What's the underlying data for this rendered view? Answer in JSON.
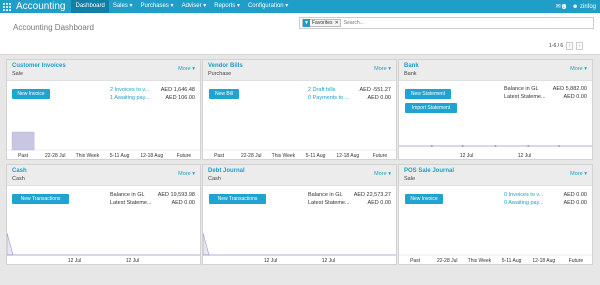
{
  "navbar": {
    "app_title": "Accounting",
    "menu": [
      {
        "label": "Dashboard",
        "active": true
      },
      {
        "label": "Sales ▾"
      },
      {
        "label": "Purchases ▾"
      },
      {
        "label": "Adviser ▾"
      },
      {
        "label": "Reports ▾"
      },
      {
        "label": "Configuration ▾"
      }
    ],
    "messages_count": "1",
    "user": "zinfog",
    "accent": "#1f9ec8"
  },
  "control_panel": {
    "title": "Accounting Dashboard",
    "facet": "Favorites",
    "facet_icon": "filter-icon",
    "search_placeholder": "Search...",
    "pager": "1-6 / 6",
    "prev": "‹",
    "next": "›"
  },
  "cards": {
    "customer_invoices": {
      "title": "Customer Invoices",
      "subtitle": "Sale",
      "more": "More ▾",
      "button": "New Invoice",
      "link1": "2 Invoices to v...",
      "amt1": "AED 1,646.48",
      "link2": "1 Awaiting pay...",
      "amt2": "AED 106.00",
      "bars": [
        {
          "label": "Past",
          "value": 1,
          "highlight": true
        },
        {
          "label": "22-28 Jul",
          "value": 0
        },
        {
          "label": "This Week",
          "value": 0
        },
        {
          "label": "5-11 Aug",
          "value": 0
        },
        {
          "label": "12-18 Aug",
          "value": 0
        },
        {
          "label": "Future",
          "value": 0
        }
      ]
    },
    "vendor_bills": {
      "title": "Vendor Bills",
      "subtitle": "Purchase",
      "more": "More ▾",
      "button": "New Bill",
      "link1": "2 Draft bills",
      "amt1": "AED -551.27",
      "link2": "0 Payments to ...",
      "amt2": "AED 0.00",
      "bars": [
        {
          "label": "Past",
          "value": 0
        },
        {
          "label": "22-28 Jul",
          "value": 0
        },
        {
          "label": "This Week",
          "value": 0
        },
        {
          "label": "5-11 Aug",
          "value": 0
        },
        {
          "label": "12-18 Aug",
          "value": 0
        },
        {
          "label": "Future",
          "value": 0
        }
      ]
    },
    "bank": {
      "title": "Bank",
      "subtitle": "Bank",
      "more": "More ▾",
      "button": "New Statement",
      "button2": "Import Statement",
      "label1": "Balance in GL",
      "amt1": "AED 5,882.00",
      "label2": "Latest Stateme...",
      "amt2": "AED 0.00",
      "ticks": [
        "12 Jul",
        "12 Jul"
      ]
    },
    "cash": {
      "title": "Cash",
      "subtitle": "Cash",
      "more": "More ▾",
      "button": "New Transactions",
      "label1": "Balance in GL",
      "amt1": "AED 19,593.98",
      "label2": "Latest Stateme...",
      "amt2": "AED 0.00",
      "ticks": [
        "12 Jul",
        "12 Jul"
      ]
    },
    "debt_journal": {
      "title": "Debt Journal",
      "subtitle": "Cash",
      "more": "More ▾",
      "button": "New Transactions",
      "label1": "Balance in GL",
      "amt1": "AED 22,573.27",
      "label2": "Latest Stateme...",
      "amt2": "AED 0.00",
      "ticks": [
        "12 Jul",
        "12 Jul"
      ]
    },
    "pos_sale_journal": {
      "title": "POS Sale Journal",
      "subtitle": "Sale",
      "more": "More ▾",
      "button": "New Invoice",
      "link1": "0 Invoices to v...",
      "amt1": "AED 0.00",
      "link2": "0 Awaiting pay...",
      "amt2": "AED 0.00",
      "bars": [
        {
          "label": "Past",
          "value": 0
        },
        {
          "label": "22-28 Jul",
          "value": 0
        },
        {
          "label": "This Week",
          "value": 0
        },
        {
          "label": "5-11 Aug",
          "value": 0
        },
        {
          "label": "12-18 Aug",
          "value": 0
        },
        {
          "label": "Future",
          "value": 0
        }
      ]
    }
  }
}
